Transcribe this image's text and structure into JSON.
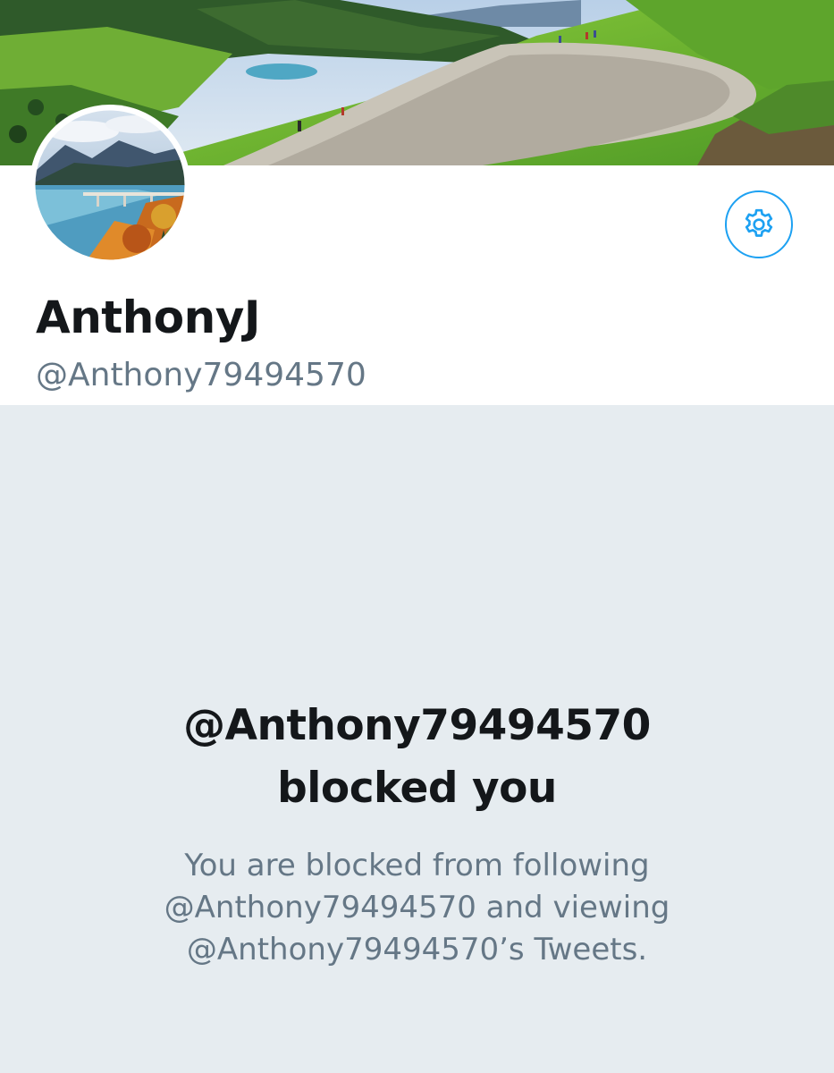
{
  "profile": {
    "display_name": "AnthonyJ",
    "handle": "@Anthony79494570"
  },
  "header": {
    "banner_image": "mountain-landscape-banner",
    "avatar_image": "lake-bridge-autumn-avatar",
    "settings_icon": "gear-icon"
  },
  "blocked_notice": {
    "title_line_1": "@Anthony79494570",
    "title_line_2": "blocked you",
    "message_line_1": "You are blocked from following",
    "message_line_2": "@Anthony79494570 and viewing",
    "message_line_3": "@Anthony79494570’s Tweets."
  },
  "colors": {
    "accent": "#1da1f2",
    "text_primary": "#14171a",
    "text_secondary": "#657786",
    "background": "#e6ecf0"
  }
}
